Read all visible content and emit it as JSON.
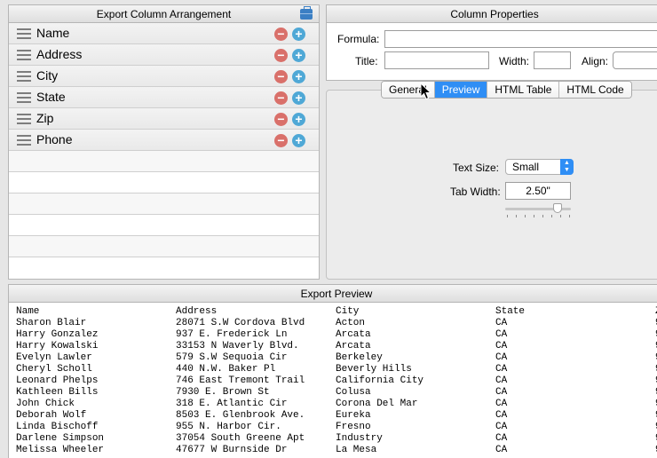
{
  "left_panel": {
    "title": "Export Column Arrangement",
    "columns": [
      "Name",
      "Address",
      "City",
      "State",
      "Zip",
      "Phone"
    ],
    "empty_rows": 5
  },
  "right_panel": {
    "title": "Column Properties",
    "formula_label": "Formula:",
    "title_label": "Title:",
    "width_label": "Width:",
    "align_label": "Align:",
    "formula_value": "",
    "title_value": "",
    "width_value": "",
    "align_value": ""
  },
  "tabs": [
    {
      "label": "General",
      "active": false
    },
    {
      "label": "Preview",
      "active": true
    },
    {
      "label": "HTML Table",
      "active": false
    },
    {
      "label": "HTML Code",
      "active": false
    }
  ],
  "preview_tab": {
    "text_size_label": "Text Size:",
    "text_size_value": "Small",
    "tab_width_label": "Tab Width:",
    "tab_width_value": "2.50\"",
    "slider_fraction": 0.8
  },
  "export_preview": {
    "title": "Export Preview",
    "headers": [
      "Name",
      "Address",
      "City",
      "State",
      "Z"
    ],
    "rows": [
      [
        "Sharon Blair",
        "28071 S.W Cordova Blvd",
        "Acton",
        "CA",
        "9"
      ],
      [
        "Harry Gonzalez",
        "937 E. Frederick Ln",
        "Arcata",
        "CA",
        "9"
      ],
      [
        "Harry Kowalski",
        "33153 N Waverly Blvd.",
        "Arcata",
        "CA",
        "9"
      ],
      [
        "Evelyn Lawler",
        "579 S.W Sequoia Cir",
        "Berkeley",
        "CA",
        "9"
      ],
      [
        "Cheryl Scholl",
        "440 N.W. Baker Pl",
        "Beverly Hills",
        "CA",
        "9"
      ],
      [
        "Leonard Phelps",
        "746 East Tremont Trail",
        "California City",
        "CA",
        "9"
      ],
      [
        "Kathleen Bills",
        "7930 E. Brown St",
        "Colusa",
        "CA",
        "9"
      ],
      [
        "John Chick",
        "318 E. Atlantic Cir",
        "Corona Del Mar",
        "CA",
        "9"
      ],
      [
        "Deborah Wolf",
        "8503 E. Glenbrook Ave.",
        "Eureka",
        "CA",
        "9"
      ],
      [
        "Linda Bischoff",
        "955 N. Harbor Cir.",
        "Fresno",
        "CA",
        "9"
      ],
      [
        "Darlene Simpson",
        "37054 South Greene Apt",
        "Industry",
        "CA",
        "9"
      ],
      [
        "Melissa Wheeler",
        "47677 W Burnside Dr",
        "La Mesa",
        "CA",
        "9"
      ]
    ]
  },
  "colors": {
    "accent": "#2f8ef5",
    "minus": "#d9706a",
    "plus": "#4fa8d6"
  }
}
